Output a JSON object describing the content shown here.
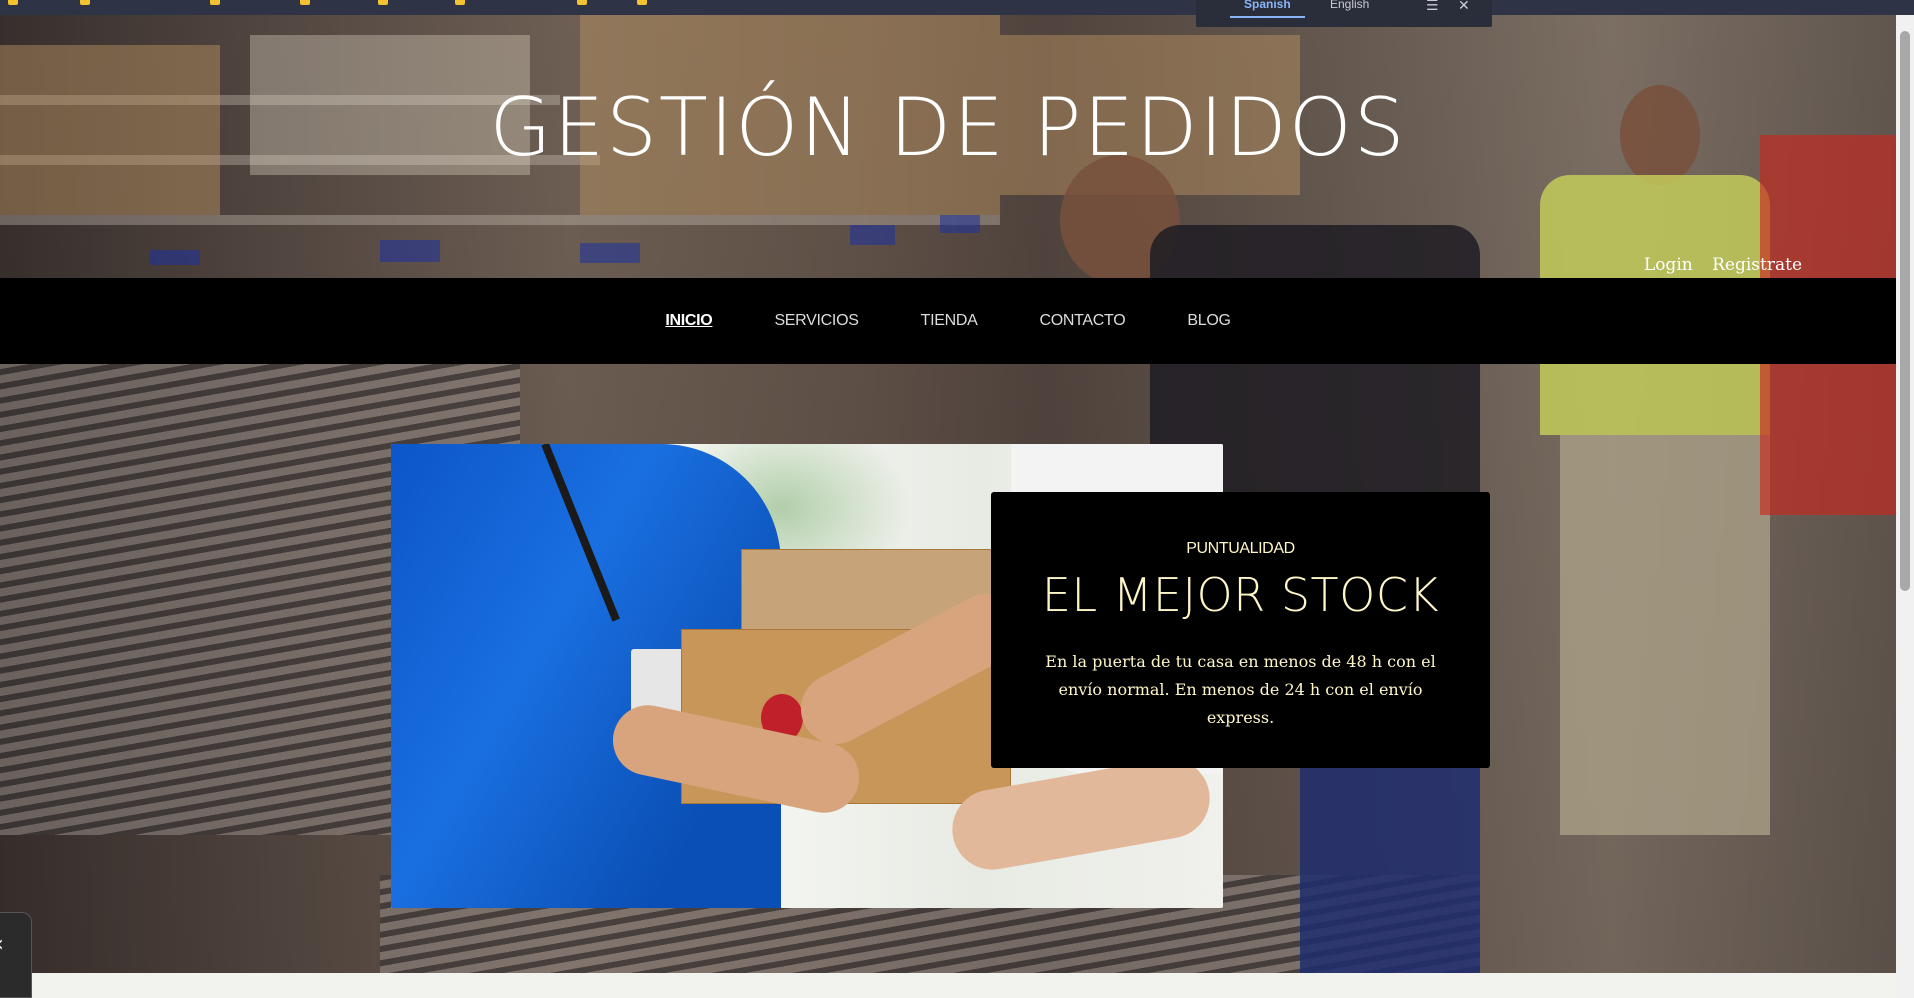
{
  "translate_bar": {
    "languages": [
      "Spanish",
      "English"
    ],
    "active_language": "Spanish",
    "menu_icon": "menu-icon",
    "close_icon": "close-icon"
  },
  "site": {
    "title": "GESTIÓN DE PEDIDOS"
  },
  "auth": {
    "login": "Login",
    "register": "Registrate"
  },
  "nav": {
    "items": [
      "INICIO",
      "SERVICIOS",
      "TIENDA",
      "CONTACTO",
      "BLOG"
    ],
    "active": "INICIO"
  },
  "feature": {
    "kicker": "PUNTUALIDAD",
    "headline": "EL MEJOR STOCK",
    "description": "En la puerta de tu casa en menos de 48 h con el envío normal. En menos de 24 h con el envío express."
  },
  "side_tab": {
    "icon": "chevron-left-icon",
    "glyph": "‹"
  },
  "colors": {
    "nav_background": "#000000",
    "card_background": "#000000",
    "card_text": "#fff6c8",
    "title_text": "#ffffff",
    "translate_accent": "#8ab4f8"
  }
}
